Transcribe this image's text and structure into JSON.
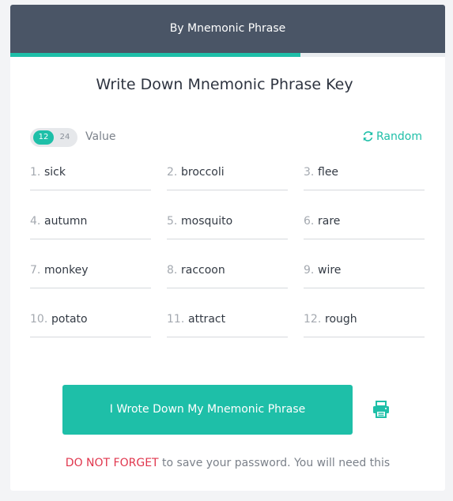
{
  "header": {
    "title": "By Mnemonic Phrase"
  },
  "progress": {
    "fraction": 0.667
  },
  "main": {
    "title": "Write Down Mnemonic Phrase Key"
  },
  "toggle": {
    "options": [
      "12",
      "24"
    ],
    "selected": "12"
  },
  "value_label": "Value",
  "random_label": "Random",
  "words": [
    {
      "num": "1.",
      "word": "sick"
    },
    {
      "num": "2.",
      "word": "broccoli"
    },
    {
      "num": "3.",
      "word": "flee"
    },
    {
      "num": "4.",
      "word": "autumn"
    },
    {
      "num": "5.",
      "word": "mosquito"
    },
    {
      "num": "6.",
      "word": "rare"
    },
    {
      "num": "7.",
      "word": "monkey"
    },
    {
      "num": "8.",
      "word": "raccoon"
    },
    {
      "num": "9.",
      "word": "wire"
    },
    {
      "num": "10.",
      "word": "potato"
    },
    {
      "num": "11.",
      "word": "attract"
    },
    {
      "num": "12.",
      "word": "rough"
    }
  ],
  "confirm_button": "I Wrote Down My Mnemonic Phrase",
  "print_icon": "printer-icon",
  "warning": {
    "highlight": "DO NOT FORGET",
    "text": " to save your password. You will need this"
  },
  "colors": {
    "accent": "#1ebfa8",
    "header_bg": "#4a5566",
    "warning": "#e0364d"
  }
}
